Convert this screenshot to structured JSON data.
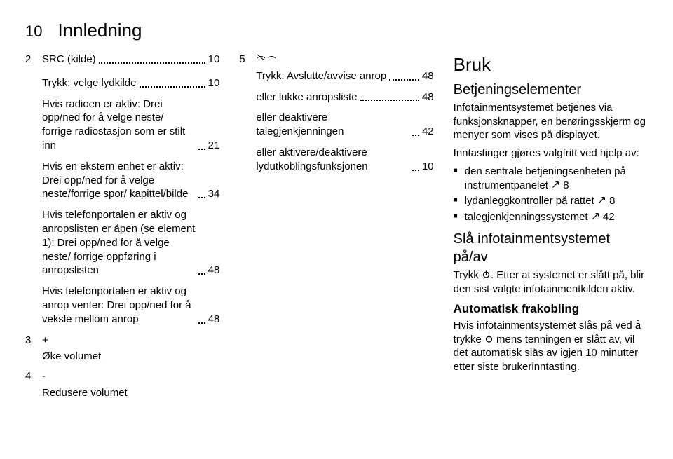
{
  "header": {
    "page_num": "10",
    "title": "Innledning"
  },
  "col1": {
    "item2": {
      "num": "2",
      "key": "SRC (kilde)",
      "pg": "10",
      "sub1_txt": "Trykk: velge lydkilde",
      "sub1_pg": "10",
      "sub2_txt": "Hvis radioen er aktiv: Drei opp/ned for å velge neste/ forrige radiostasjon som er stilt inn",
      "sub2_pg": "21",
      "sub3_txt": "Hvis en ekstern enhet er aktiv: Drei opp/ned for å velge neste/forrige spor/ kapittel/bilde",
      "sub3_pg": "34",
      "sub4_txt": "Hvis telefonportalen er aktiv og anropslisten er åpen (se element 1): Drei opp/ned for å velge neste/ forrige oppføring i anropslisten",
      "sub4_pg": "48",
      "sub5_txt": "Hvis telefonportalen er aktiv og anrop venter: Drei opp/ned for å veksle mellom anrop",
      "sub5_pg": "48"
    },
    "item3": {
      "num": "3",
      "key": "+",
      "line": "Øke volumet"
    },
    "item4": {
      "num": "4",
      "key": "-",
      "line": "Redusere volumet"
    }
  },
  "col2": {
    "item5": {
      "num": "5",
      "sub1_txt": "Trykk: Avslutte/avvise anrop",
      "sub1_pg": "48",
      "sub2_txt": "eller lukke anropsliste",
      "sub2_pg": "48",
      "sub3_txt": "eller deaktivere talegjenkjenningen",
      "sub3_pg": "42",
      "sub4_txt": "eller aktivere/deaktivere lydutkoblingsfunksjonen",
      "sub4_pg": "10"
    }
  },
  "col3": {
    "h2": "Bruk",
    "h3a": "Betjeningselementer",
    "p1": "Infotainmentsystemet betjenes via funksjonsknapper, en berøringsskjerm og menyer som vises på displayet.",
    "p2": "Inntastinger gjøres valgfritt ved hjelp av:",
    "b1_pre": "den sentrale betjeningsenheten på instrumentpanelet ",
    "b1_ref": " 8",
    "b2_pre": "lydanleggkontroller på rattet ",
    "b2_ref": " 8",
    "b3_pre": "talegjenkjenningssystemet ",
    "b3_ref": " 42",
    "h3b": "Slå infotainmentsystemet på/av",
    "p3_pre": "Trykk ",
    "p3_post": ". Etter at systemet er slått på, blir den sist valgte infotainmentkilden aktiv.",
    "h4": "Automatisk frakobling",
    "p4_pre": "Hvis infotainmentsystemet slås på ved å trykke ",
    "p4_post": " mens tenningen er slått av, vil det automatisk slås av igjen 10 minutter etter siste brukerinntasting."
  }
}
